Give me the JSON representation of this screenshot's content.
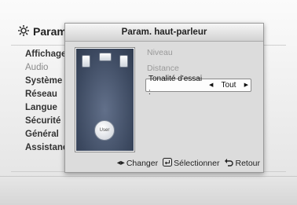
{
  "background": {
    "title": "Param",
    "menu": [
      {
        "label": "Affichage",
        "dim": false
      },
      {
        "label": "Audio",
        "dim": true
      },
      {
        "label": "Système",
        "dim": false
      },
      {
        "label": "Réseau",
        "dim": false
      },
      {
        "label": "Langue",
        "dim": false
      },
      {
        "label": "Sécurité",
        "dim": false
      },
      {
        "label": "Général",
        "dim": false
      },
      {
        "label": "Assistance",
        "dim": false
      }
    ]
  },
  "dialog": {
    "title": "Param. haut-parleur",
    "options": {
      "niveau": "Niveau",
      "distance": "Distance",
      "tonalite_label": "Tonalité d'essai :",
      "tonalite_value": "Tout"
    },
    "preview_user_label": "User",
    "footer": {
      "change": "Changer",
      "select": "Sélectionner",
      "back": "Retour"
    }
  },
  "colors": {
    "dialog_bg": "#dcdcdc",
    "preview_bg": "#3d4a5c",
    "text": "#222222"
  }
}
